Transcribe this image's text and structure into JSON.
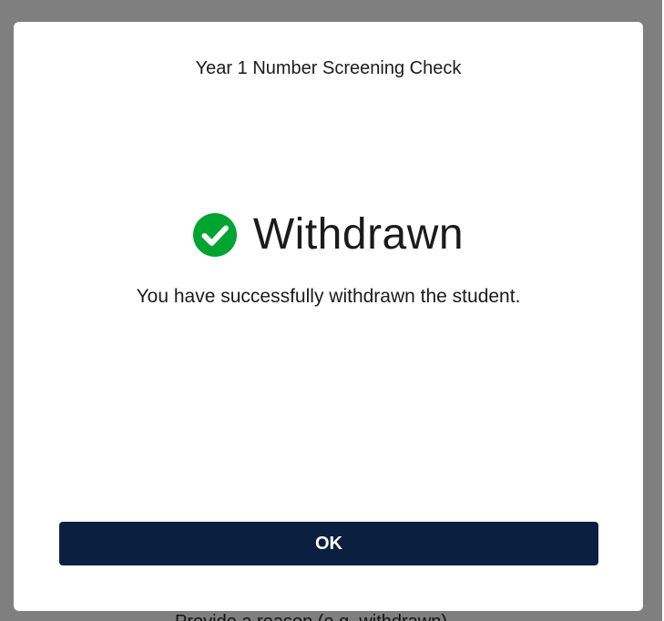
{
  "background_page": {
    "partial_text": "Provide a reason (e.g. withdrawn)"
  },
  "modal": {
    "title": "Year 1 Number Screening Check",
    "status_icon": "check-circle-icon",
    "status_heading": "Withdrawn",
    "message": "You have successfully withdrawn the student.",
    "ok_label": "OK"
  },
  "colors": {
    "overlay": "#7f7f7f",
    "modal_bg": "#ffffff",
    "success_green": "#00a430",
    "button_bg": "#0b1f40",
    "button_text": "#ffffff",
    "text": "#1b1b1b"
  }
}
